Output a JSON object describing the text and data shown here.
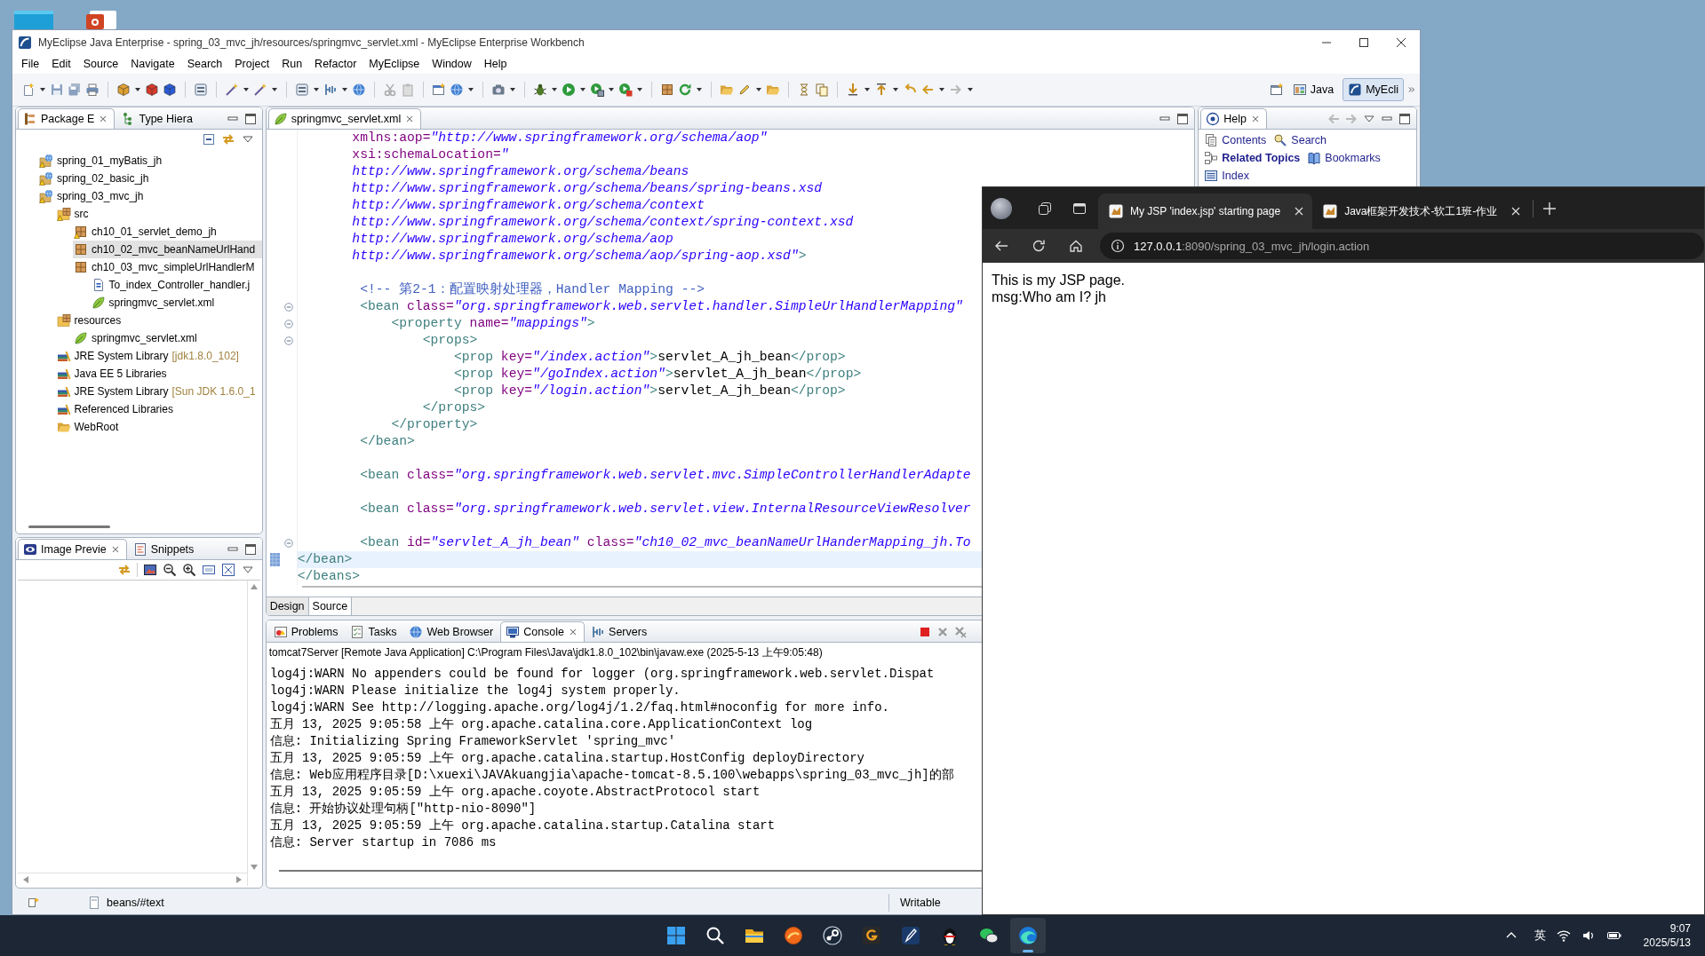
{
  "eclipse": {
    "title": "MyEclipse Java Enterprise - spring_03_mvc_jh/resources/springmvc_servlet.xml - MyEclipse Enterprise Workbench",
    "menu": [
      "File",
      "Edit",
      "Source",
      "Navigate",
      "Search",
      "Project",
      "Run",
      "Refactor",
      "MyEclipse",
      "Window",
      "Help"
    ],
    "perspectives": [
      {
        "label": "Java",
        "kind": "java",
        "selected": false
      },
      {
        "label": "MyEcli",
        "kind": "myeclipse",
        "selected": true
      }
    ],
    "explorer": {
      "tabs": [
        {
          "label": "Package E",
          "kind": "package",
          "selected": true
        },
        {
          "label": "Type Hiera",
          "kind": "hierarchy",
          "selected": false
        }
      ],
      "tree": [
        {
          "label": "spring_01_myBatis_jh",
          "kind": "project",
          "warning": true,
          "selected": false
        },
        {
          "label": "spring_02_basic_jh",
          "kind": "project",
          "warning": true,
          "selected": false
        },
        {
          "label": "spring_03_mvc_jh",
          "kind": "project",
          "warning": true,
          "selected": false,
          "children": [
            {
              "label": "src",
              "kind": "source-folder",
              "warning": true,
              "selected": false,
              "children": [
                {
                  "label": "ch10_01_servlet_demo_jh",
                  "kind": "package",
                  "warning": true,
                  "selected": false
                },
                {
                  "label": "ch10_02_mvc_beanNameUrlHand",
                  "kind": "package",
                  "warning": false,
                  "selected": true
                },
                {
                  "label": "ch10_03_mvc_simpleUrlHandlerM",
                  "kind": "package",
                  "warning": false,
                  "selected": false,
                  "children": [
                    {
                      "label": "To_index_Controller_handler.j",
                      "kind": "java-file",
                      "warning": false,
                      "selected": false
                    },
                    {
                      "label": "springmvc_servlet.xml",
                      "kind": "xml-file",
                      "warning": false,
                      "selected": false
                    }
                  ]
                }
              ]
            },
            {
              "label": "resources",
              "kind": "source-folder",
              "warning": false,
              "selected": false,
              "children": [
                {
                  "label": "springmvc_servlet.xml",
                  "kind": "xml-file",
                  "warning": false,
                  "selected": false
                }
              ]
            },
            {
              "label": "JRE System Library",
              "decoration": "[jdk1.8.0_102]",
              "kind": "library",
              "warning": false,
              "selected": false
            },
            {
              "label": "Java EE 5 Libraries",
              "kind": "library",
              "warning": false,
              "selected": false
            },
            {
              "label": "JRE System Library",
              "decoration": "[Sun JDK 1.6.0_1",
              "kind": "library",
              "warning": false,
              "selected": false
            },
            {
              "label": "Referenced Libraries",
              "kind": "library",
              "warning": false,
              "selected": false
            },
            {
              "label": "WebRoot",
              "kind": "folder",
              "warning": false,
              "selected": false
            }
          ]
        }
      ]
    },
    "image_preview": {
      "tabs": [
        {
          "label": "Image Previe",
          "kind": "image",
          "selected": true
        },
        {
          "label": "Snippets",
          "kind": "snippets",
          "selected": false
        }
      ]
    },
    "editor": {
      "tabs": [
        {
          "label": "springmvc_servlet.xml",
          "kind": "xml",
          "selected": true
        }
      ],
      "lines": [
        {
          "fold": false,
          "current": false,
          "parts": [
            {
              "kind": "attr",
              "text": "       xmlns:aop="
            },
            {
              "kind": "val",
              "text": "\"http://www.springframework.org/schema/aop\""
            }
          ]
        },
        {
          "fold": false,
          "current": false,
          "parts": [
            {
              "kind": "attr",
              "text": "       xsi:schemaLocation="
            },
            {
              "kind": "val",
              "text": "\""
            }
          ]
        },
        {
          "fold": false,
          "current": false,
          "parts": [
            {
              "kind": "val",
              "text": "       http://www.springframework.org/schema/beans"
            }
          ]
        },
        {
          "fold": false,
          "current": false,
          "parts": [
            {
              "kind": "val",
              "text": "       http://www.springframework.org/schema/beans/spring-beans.xsd"
            }
          ]
        },
        {
          "fold": false,
          "current": false,
          "parts": [
            {
              "kind": "val",
              "text": "       http://www.springframework.org/schema/context"
            }
          ]
        },
        {
          "fold": false,
          "current": false,
          "parts": [
            {
              "kind": "val",
              "text": "       http://www.springframework.org/schema/context/spring-context.xsd"
            }
          ]
        },
        {
          "fold": false,
          "current": false,
          "parts": [
            {
              "kind": "val",
              "text": "       http://www.springframework.org/schema/aop"
            }
          ]
        },
        {
          "fold": false,
          "current": false,
          "parts": [
            {
              "kind": "val",
              "text": "       http://www.springframework.org/schema/aop/spring-aop.xsd\""
            },
            {
              "kind": "tag",
              "text": ">"
            }
          ]
        },
        {
          "fold": false,
          "current": false
        },
        {
          "fold": false,
          "current": false,
          "parts": [
            {
              "kind": "comment",
              "text": "        <!-- 第2-1：配置映射处理器，Handler Mapping -->"
            }
          ]
        },
        {
          "fold": true,
          "current": false,
          "parts": [
            {
              "kind": "tag",
              "text": "        <bean "
            },
            {
              "kind": "attr",
              "text": "class="
            },
            {
              "kind": "val",
              "text": "\"org.springframework.web.servlet.handler.SimpleUrlHandlerMapping\""
            }
          ]
        },
        {
          "fold": true,
          "current": false,
          "parts": [
            {
              "kind": "tag",
              "text": "            <property "
            },
            {
              "kind": "attr",
              "text": "name="
            },
            {
              "kind": "val",
              "text": "\"mappings\""
            },
            {
              "kind": "tag",
              "text": ">"
            }
          ]
        },
        {
          "fold": true,
          "current": false,
          "parts": [
            {
              "kind": "tag",
              "text": "                <props>"
            }
          ]
        },
        {
          "fold": false,
          "current": false,
          "parts": [
            {
              "kind": "tag",
              "text": "                    <prop "
            },
            {
              "kind": "attr",
              "text": "key="
            },
            {
              "kind": "val",
              "text": "\"/index.action\""
            },
            {
              "kind": "tag",
              "text": ">"
            },
            {
              "kind": "text",
              "text": "servlet_A_jh_bean"
            },
            {
              "kind": "tag",
              "text": "</prop>"
            }
          ]
        },
        {
          "fold": false,
          "current": false,
          "parts": [
            {
              "kind": "tag",
              "text": "                    <prop "
            },
            {
              "kind": "attr",
              "text": "key="
            },
            {
              "kind": "val",
              "text": "\"/goIndex.action\""
            },
            {
              "kind": "tag",
              "text": ">"
            },
            {
              "kind": "text",
              "text": "servlet_A_jh_bean"
            },
            {
              "kind": "tag",
              "text": "</prop>"
            }
          ]
        },
        {
          "fold": false,
          "current": false,
          "parts": [
            {
              "kind": "tag",
              "text": "                    <prop "
            },
            {
              "kind": "attr",
              "text": "key="
            },
            {
              "kind": "val",
              "text": "\"/login.action\""
            },
            {
              "kind": "tag",
              "text": ">"
            },
            {
              "kind": "text",
              "text": "servlet_A_jh_bean"
            },
            {
              "kind": "tag",
              "text": "</prop>"
            }
          ]
        },
        {
          "fold": false,
          "current": false,
          "parts": [
            {
              "kind": "tag",
              "text": "                </props>"
            }
          ]
        },
        {
          "fold": false,
          "current": false,
          "parts": [
            {
              "kind": "tag",
              "text": "            </property>"
            }
          ]
        },
        {
          "fold": false,
          "current": false,
          "parts": [
            {
              "kind": "tag",
              "text": "        </bean>"
            }
          ]
        },
        {
          "fold": false,
          "current": false
        },
        {
          "fold": false,
          "current": false,
          "parts": [
            {
              "kind": "tag",
              "text": "        <bean "
            },
            {
              "kind": "attr",
              "text": "class="
            },
            {
              "kind": "val",
              "text": "\"org.springframework.web.servlet.mvc.SimpleControllerHandlerAdapte"
            }
          ]
        },
        {
          "fold": false,
          "current": false
        },
        {
          "fold": false,
          "current": false,
          "parts": [
            {
              "kind": "tag",
              "text": "        <bean "
            },
            {
              "kind": "attr",
              "text": "class="
            },
            {
              "kind": "val",
              "text": "\"org.springframework.web.servlet.view.InternalResourceViewResolver"
            }
          ]
        },
        {
          "fold": false,
          "current": false
        },
        {
          "fold": true,
          "current": false,
          "parts": [
            {
              "kind": "tag",
              "text": "        <bean "
            },
            {
              "kind": "attr",
              "text": "id="
            },
            {
              "kind": "val",
              "text": "\"servlet_A_jh_bean\" "
            },
            {
              "kind": "attr",
              "text": "class="
            },
            {
              "kind": "val",
              "text": "\"ch10_02_mvc_beanNameUrlHanderMapping_jh.To"
            }
          ]
        },
        {
          "fold": false,
          "current": true,
          "parts": [
            {
              "kind": "tag",
              "text": "</bean>"
            }
          ]
        },
        {
          "fold": false,
          "current": false,
          "parts": [
            {
              "kind": "tag",
              "text": "</beans>"
            }
          ]
        }
      ],
      "mode_tabs": [
        {
          "label": "Design",
          "selected": false
        },
        {
          "label": "Source",
          "selected": true
        }
      ]
    },
    "help": {
      "tabs": [
        {
          "label": "Help",
          "kind": "help",
          "selected": true
        }
      ],
      "links": [
        {
          "label": "Contents",
          "kind": "contents",
          "selected": false
        },
        {
          "label": "Search",
          "kind": "search",
          "selected": false
        },
        {
          "label": "Related Topics",
          "kind": "related",
          "selected": true
        },
        {
          "label": "Bookmarks",
          "kind": "bookmarks",
          "selected": false
        },
        {
          "label": "Index",
          "kind": "index",
          "selected": false
        }
      ]
    },
    "console": {
      "tabs": [
        {
          "label": "Problems",
          "kind": "problems",
          "selected": false
        },
        {
          "label": "Tasks",
          "kind": "tasks",
          "selected": false
        },
        {
          "label": "Web Browser",
          "kind": "browser",
          "selected": false
        },
        {
          "label": "Console",
          "kind": "console",
          "selected": true
        },
        {
          "label": "Servers",
          "kind": "servers",
          "selected": false
        }
      ],
      "header": "tomcat7Server [Remote Java Application] C:\\Program Files\\Java\\jdk1.8.0_102\\bin\\javaw.exe (2025-5-13 上午9:05:48)",
      "lines": [
        "log4j:WARN No appenders could be found for logger (org.springframework.web.servlet.Dispat",
        "log4j:WARN Please initialize the log4j system properly.",
        "log4j:WARN See http://logging.apache.org/log4j/1.2/faq.html#noconfig for more info.",
        "五月 13, 2025 9:05:58 上午 org.apache.catalina.core.ApplicationContext log",
        "信息: Initializing Spring FrameworkServlet 'spring_mvc'",
        "五月 13, 2025 9:05:59 上午 org.apache.catalina.startup.HostConfig deployDirectory",
        "信息: Web应用程序目录[D:\\xuexi\\JAVAkuangjia\\apache-tomcat-8.5.100\\webapps\\spring_03_mvc_jh]的部",
        "五月 13, 2025 9:05:59 上午 org.apache.coyote.AbstractProtocol start",
        "信息: 开始协议处理句柄[\"http-nio-8090\"]",
        "五月 13, 2025 9:05:59 上午 org.apache.catalina.startup.Catalina start",
        "信息: Server startup in 7086 ms"
      ]
    },
    "status_bar": {
      "path": "beans/#text",
      "mode": "Writable"
    }
  },
  "browser": {
    "tabs": [
      {
        "title": "My JSP 'index.jsp' starting page",
        "selected": true
      },
      {
        "title": "Java框架开发技术-软工1班-作业",
        "selected": false
      }
    ],
    "url": "**127.0.0.1**:8090/spring_03_mvc_jh/login.action",
    "page_lines": [
      "This is my JSP page.",
      "msg:Who am I? jh"
    ]
  },
  "taskbar": {
    "apps": [
      {
        "kind": "start",
        "active": false
      },
      {
        "kind": "search",
        "active": false
      },
      {
        "kind": "files",
        "active": false
      },
      {
        "kind": "swirl",
        "active": false
      },
      {
        "kind": "steam",
        "active": false
      },
      {
        "kind": "ring",
        "active": false
      },
      {
        "kind": "pen",
        "active": false
      },
      {
        "kind": "penguin",
        "active": false
      },
      {
        "kind": "chat",
        "active": false
      },
      {
        "kind": "wave",
        "active": true
      }
    ],
    "ime": "英",
    "time": "9:07",
    "date": "2025/5/13"
  }
}
